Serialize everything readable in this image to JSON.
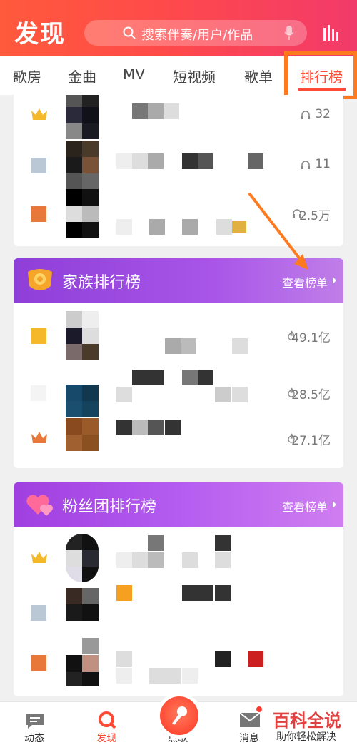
{
  "header": {
    "title": "发现",
    "search_placeholder": "搜索伴奏/用户/作品"
  },
  "tabs": [
    {
      "label": "歌房",
      "active": false
    },
    {
      "label": "金曲",
      "active": false
    },
    {
      "label": "MV",
      "active": false
    },
    {
      "label": "短视频",
      "active": false
    },
    {
      "label": "歌单",
      "active": false
    },
    {
      "label": "排行榜",
      "active": true
    }
  ],
  "top_card": {
    "rows": [
      {
        "rank": 1,
        "rank_style": "crown-gold",
        "metric": "32",
        "metric_icon": "headphones-icon"
      },
      {
        "rank": 2,
        "rank_style": "square-silver",
        "metric": "11",
        "metric_icon": "headphones-icon"
      },
      {
        "rank": 3,
        "rank_style": "square-bronze",
        "metric": "2.5万",
        "metric_icon": "headphones-icon"
      }
    ]
  },
  "family_card": {
    "title": "家族排行榜",
    "more_label": "查看榜单",
    "rows": [
      {
        "rank": 1,
        "rank_style": "square-gold",
        "metric": "49.1亿",
        "metric_icon": "flame-icon"
      },
      {
        "rank": 2,
        "rank_style": "square-silver",
        "metric": "28.5亿",
        "metric_icon": "flame-icon"
      },
      {
        "rank": 3,
        "rank_style": "crown-bronze",
        "metric": "27.1亿",
        "metric_icon": "flame-icon"
      }
    ]
  },
  "fan_card": {
    "title": "粉丝团排行榜",
    "more_label": "查看榜单",
    "rows": [
      {
        "rank": 1,
        "rank_style": "crown-gold",
        "metric": "",
        "metric_icon": ""
      },
      {
        "rank": 2,
        "rank_style": "square-silver",
        "metric": "",
        "metric_icon": ""
      },
      {
        "rank": 3,
        "rank_style": "square-bronze",
        "metric": "",
        "metric_icon": ""
      }
    ]
  },
  "bottom_nav": [
    {
      "label": "动态",
      "icon": "message-bubble-icon",
      "active": false
    },
    {
      "label": "发现",
      "icon": "discover-icon",
      "active": true
    },
    {
      "label": "点歌",
      "icon": "microphone-icon",
      "active": false
    },
    {
      "label": "消息",
      "icon": "mail-icon",
      "active": false
    }
  ],
  "watermark": {
    "line1": "百科全说",
    "line2": "助你轻松解决"
  },
  "colors": {
    "accent": "#ff4a35",
    "highlight_box": "#ff7a1f",
    "family_header": "#8e3fd8",
    "fan_header": "#a03fe0",
    "gold": "#f5b82a",
    "silver": "#b9c8d4",
    "bronze": "#e8783a"
  }
}
